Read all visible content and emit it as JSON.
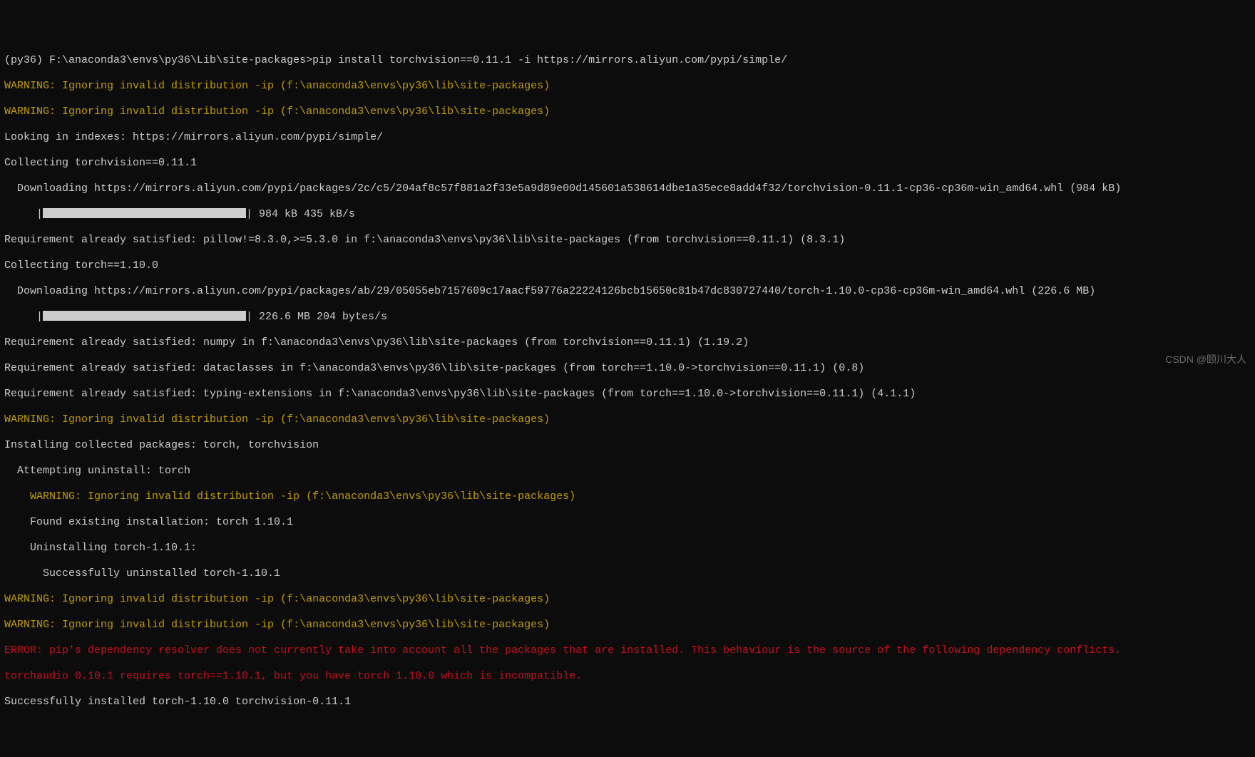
{
  "prompt": {
    "env": "(py36) ",
    "path": "F:\\anaconda3\\envs\\py36\\Lib\\site-packages>",
    "command": "pip install torchvision==0.11.1 -i https://mirrors.aliyun.com/pypi/simple/"
  },
  "output": {
    "warn1": "WARNING: Ignoring invalid distribution -ip (f:\\anaconda3\\envs\\py36\\lib\\site-packages)",
    "warn2": "WARNING: Ignoring invalid distribution -ip (f:\\anaconda3\\envs\\py36\\lib\\site-packages)",
    "looking": "Looking in indexes: https://mirrors.aliyun.com/pypi/simple/",
    "collecting_tv": "Collecting torchvision==0.11.1",
    "download_tv": "  Downloading https://mirrors.aliyun.com/pypi/packages/2c/c5/204af8c57f881a2f33e5a9d89e00d145601a538614dbe1a35ece8add4f32/torchvision-0.11.1-cp36-cp36m-win_amd64.whl (984 kB)",
    "progress_tv_prefix": "     |",
    "progress_tv_suffix": "| 984 kB 435 kB/s",
    "req_pillow": "Requirement already satisfied: pillow!=8.3.0,>=5.3.0 in f:\\anaconda3\\envs\\py36\\lib\\site-packages (from torchvision==0.11.1) (8.3.1)",
    "collecting_torch": "Collecting torch==1.10.0",
    "download_torch": "  Downloading https://mirrors.aliyun.com/pypi/packages/ab/29/05055eb7157609c17aacf59776a22224126bcb15650c81b47dc830727440/torch-1.10.0-cp36-cp36m-win_amd64.whl (226.6 MB)",
    "progress_torch_prefix": "     |",
    "progress_torch_suffix": "| 226.6 MB 204 bytes/s",
    "req_numpy": "Requirement already satisfied: numpy in f:\\anaconda3\\envs\\py36\\lib\\site-packages (from torchvision==0.11.1) (1.19.2)",
    "req_dataclasses": "Requirement already satisfied: dataclasses in f:\\anaconda3\\envs\\py36\\lib\\site-packages (from torch==1.10.0->torchvision==0.11.1) (0.8)",
    "req_typing": "Requirement already satisfied: typing-extensions in f:\\anaconda3\\envs\\py36\\lib\\site-packages (from torch==1.10.0->torchvision==0.11.1) (4.1.1)",
    "warn3": "WARNING: Ignoring invalid distribution -ip (f:\\anaconda3\\envs\\py36\\lib\\site-packages)",
    "installing": "Installing collected packages: torch, torchvision",
    "attempting": "  Attempting uninstall: torch",
    "warn4": "    WARNING: Ignoring invalid distribution -ip (f:\\anaconda3\\envs\\py36\\lib\\site-packages)",
    "found_existing": "    Found existing installation: torch 1.10.1",
    "uninstalling": "    Uninstalling torch-1.10.1:",
    "uninstalled": "      Successfully uninstalled torch-1.10.1",
    "warn5": "WARNING: Ignoring invalid distribution -ip (f:\\anaconda3\\envs\\py36\\lib\\site-packages)",
    "warn6": "WARNING: Ignoring invalid distribution -ip (f:\\anaconda3\\envs\\py36\\lib\\site-packages)",
    "error1": "ERROR: pip's dependency resolver does not currently take into account all the packages that are installed. This behaviour is the source of the following dependency conflicts.",
    "error2": "torchaudio 0.10.1 requires torch==1.10.1, but you have torch 1.10.0 which is incompatible.",
    "success": "Successfully installed torch-1.10.0 torchvision-0.11.1"
  },
  "watermark": "CSDN @颐川大人"
}
